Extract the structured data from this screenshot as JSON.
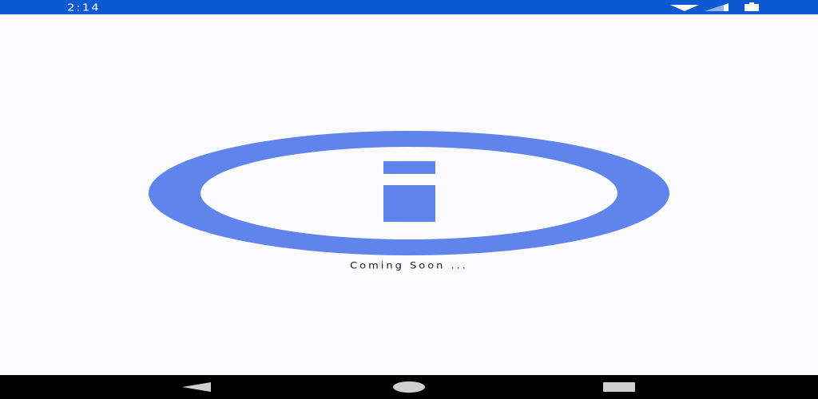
{
  "status_bar": {
    "time": "2:14",
    "color": "#0b5ad1",
    "icons": [
      "wifi-icon",
      "signal-icon",
      "battery-icon"
    ]
  },
  "main": {
    "message": "Coming Soon ...",
    "graphic_icon": "info-icon",
    "accent_color": "#5f84eb"
  },
  "nav_bar": {
    "buttons": [
      "back-icon",
      "home-icon",
      "recents-icon"
    ]
  }
}
